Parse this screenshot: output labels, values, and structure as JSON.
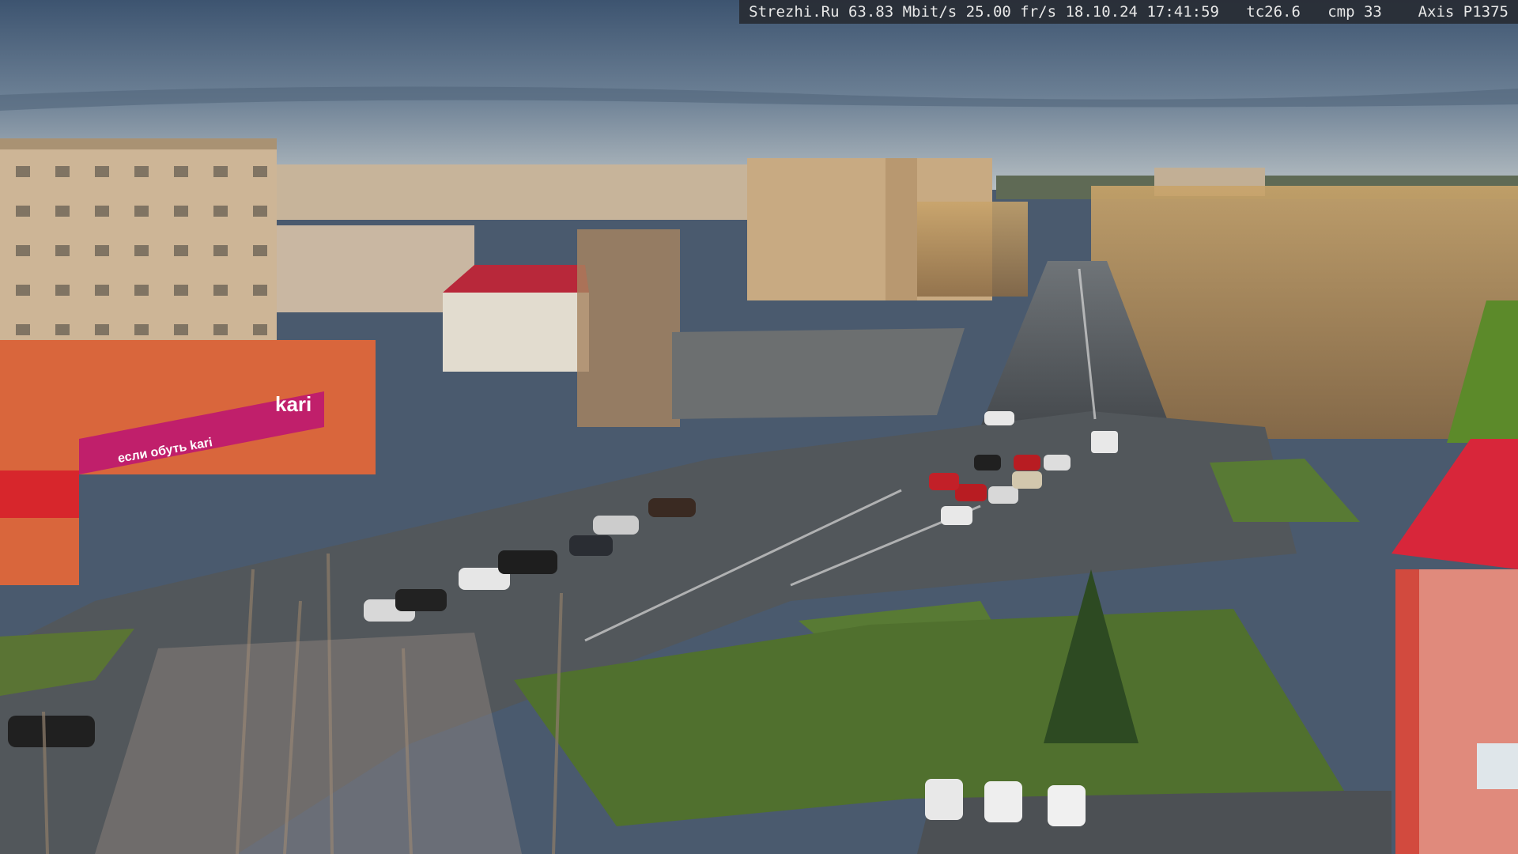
{
  "osd": {
    "text": "Strezhi.Ru 63.83 Mbit/s 25.00 fr/s 18.10.24 17:41:59   tc26.6   cmp 33    Axis P1375"
  },
  "signs": {
    "store_name": "kari",
    "store_slogan": "если обуть kari"
  },
  "colors": {
    "sky_top": "#3f5670",
    "sky_bottom": "#aab4bc",
    "asphalt": "#4e5358",
    "grass": "#4f6a2c",
    "building_beige": "#c9b08e",
    "store_orange": "#d9663c",
    "store_magenta": "#c01f6b"
  }
}
